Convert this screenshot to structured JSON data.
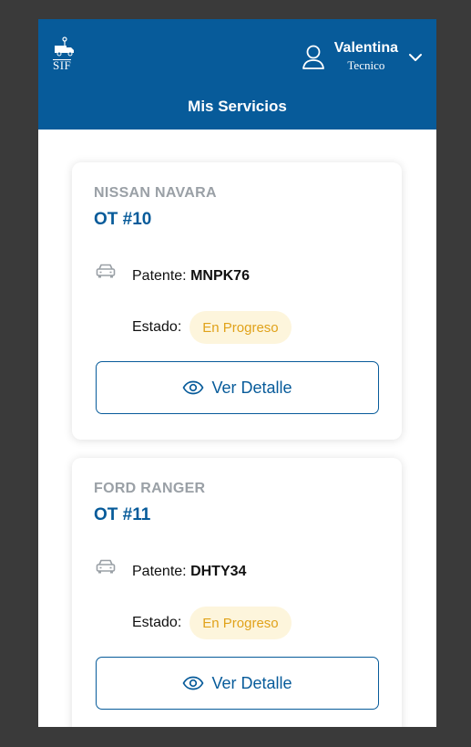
{
  "header": {
    "logo_text": "SIF",
    "user_name": "Valentina",
    "user_role": "Tecnico",
    "page_title": "Mis Servicios"
  },
  "services": [
    {
      "vehicle": "NISSAN NAVARA",
      "ot": "OT #10",
      "plate_label": "Patente:",
      "plate": "MNPK76",
      "status_label": "Estado:",
      "status": "En Progreso",
      "button_label": "Ver Detalle"
    },
    {
      "vehicle": "FORD RANGER",
      "ot": "OT #11",
      "plate_label": "Patente:",
      "plate": "DHTY34",
      "status_label": "Estado:",
      "status": "En Progreso",
      "button_label": "Ver Detalle"
    }
  ],
  "icons": {
    "logo": "tow-truck-icon",
    "user": "user-icon",
    "chevron": "chevron-down-icon",
    "vehicle": "car-icon",
    "detail": "eye-icon"
  },
  "colors": {
    "primary": "#075b9a",
    "status_bg": "#fdf5dc",
    "status_text": "#e0a21a",
    "muted": "#9aa0a6"
  }
}
